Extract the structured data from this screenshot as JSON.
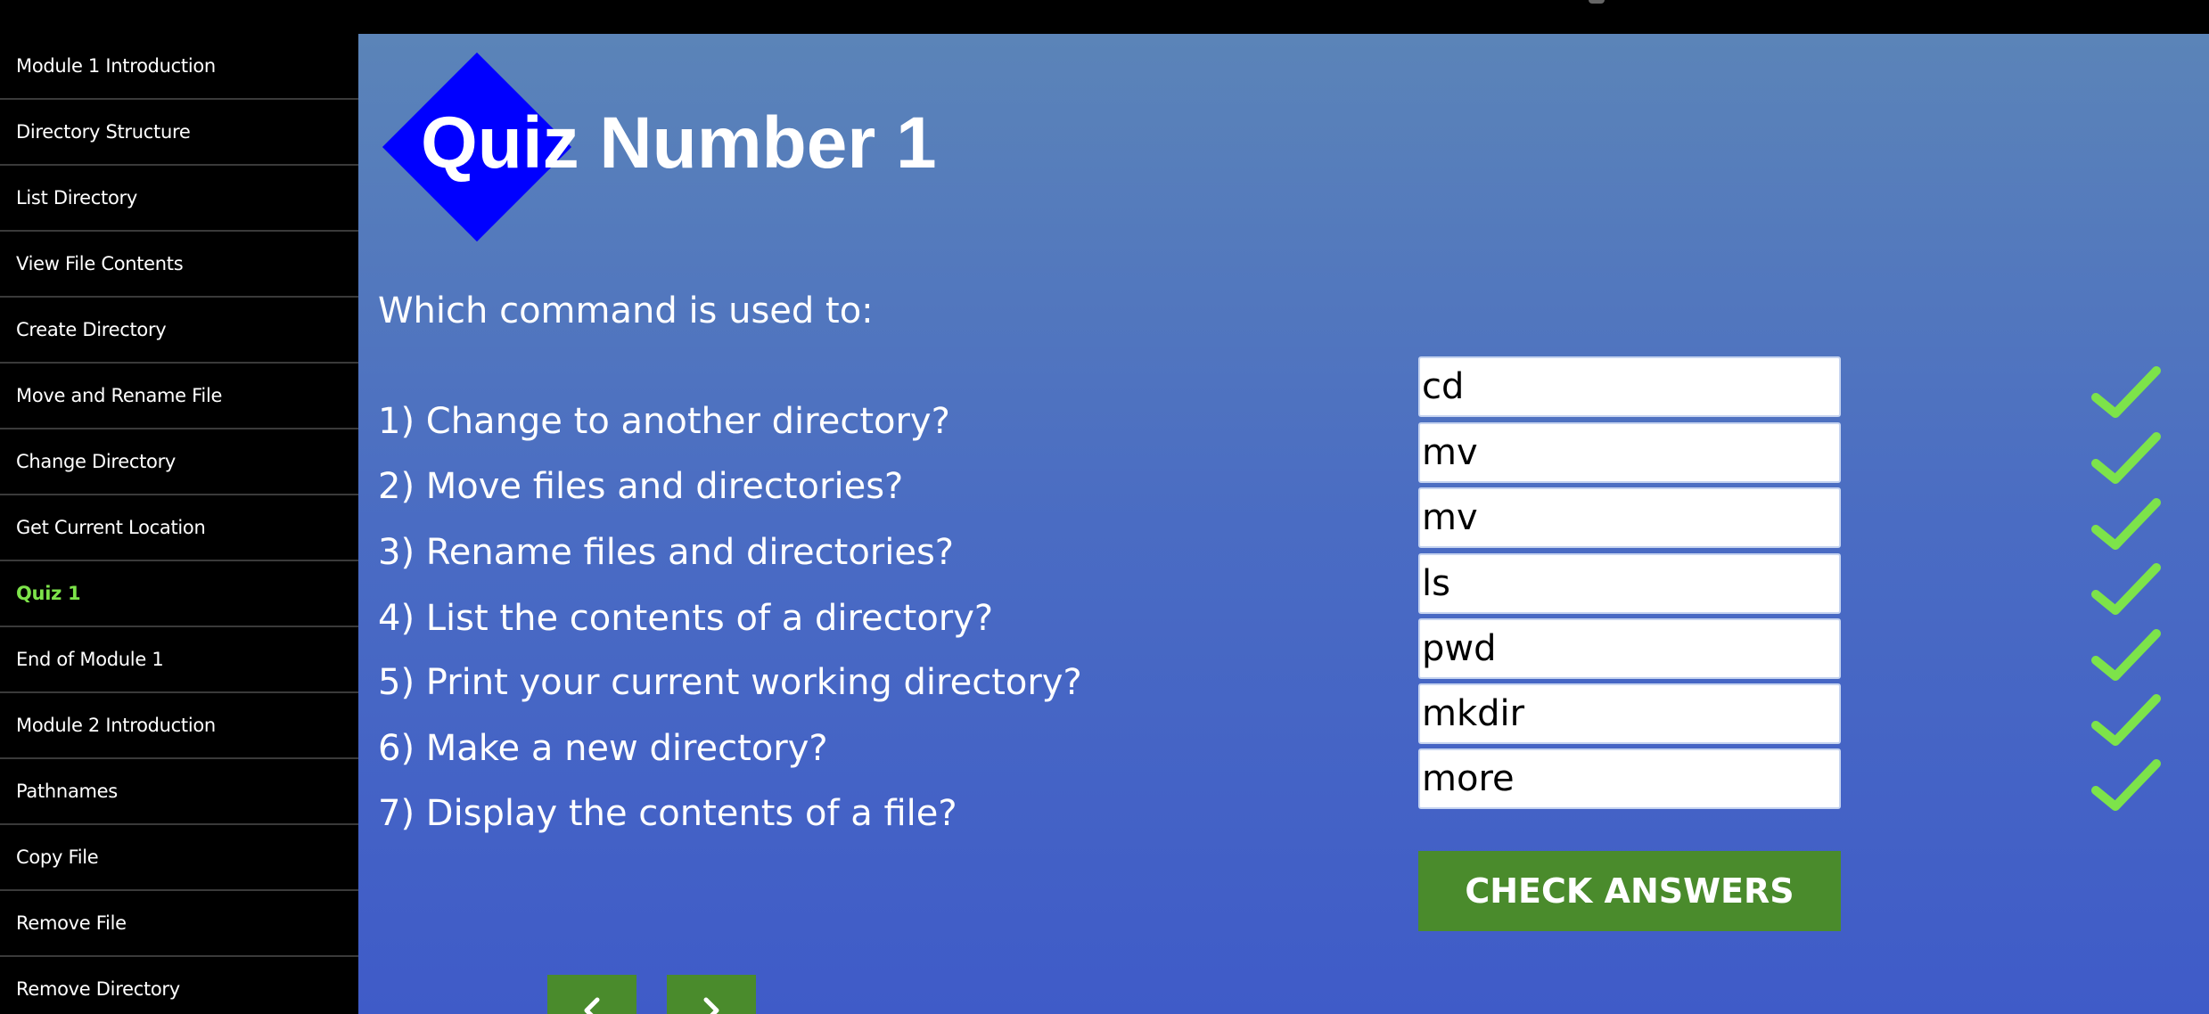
{
  "sidebar": {
    "items": [
      {
        "label": "Module 1 Introduction"
      },
      {
        "label": "Directory Structure"
      },
      {
        "label": "List Directory"
      },
      {
        "label": "View File Contents"
      },
      {
        "label": "Create Directory"
      },
      {
        "label": "Move and Rename File"
      },
      {
        "label": "Change Directory"
      },
      {
        "label": "Get Current Location"
      },
      {
        "label": "Quiz 1"
      },
      {
        "label": "End of Module 1"
      },
      {
        "label": "Module 2 Introduction"
      },
      {
        "label": "Pathnames"
      },
      {
        "label": "Copy File"
      },
      {
        "label": "Remove File"
      },
      {
        "label": "Remove Directory"
      }
    ],
    "active_index": 8,
    "active_color": "#7de34a"
  },
  "main": {
    "title": "Quiz Number 1",
    "logo_color": "#0000ff",
    "prompt": "Which command is used to:",
    "questions": [
      {
        "text": "1) Change to another directory?",
        "answer": "cd",
        "status": "correct"
      },
      {
        "text": "2) Move files and directories?",
        "answer": "mv",
        "status": "correct"
      },
      {
        "text": "3) Rename files and directories?",
        "answer": "mv",
        "status": "correct"
      },
      {
        "text": "4) List the contents of a directory?",
        "answer": "ls",
        "status": "correct"
      },
      {
        "text": "5) Print your current working directory?",
        "answer": "pwd",
        "status": "correct"
      },
      {
        "text": "6) Make a new directory?",
        "answer": "mkdir",
        "status": "correct"
      },
      {
        "text": "7) Display the contents of a file?",
        "answer": "more",
        "status": "correct"
      }
    ],
    "check_icon": "checkmark-icon",
    "check_color": "#7de34a",
    "check_button_label": "CHECK ANSWERS",
    "button_color": "#4a8b2c",
    "nav": {
      "prev_icon": "chevron-left-icon",
      "next_icon": "chevron-right-icon"
    }
  }
}
